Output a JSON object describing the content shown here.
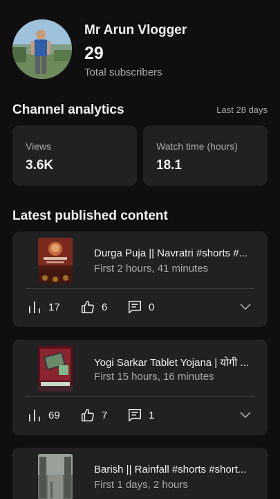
{
  "channel": {
    "name": "Mr Arun Vlogger",
    "subscriber_count": "29",
    "subscriber_label": "Total subscribers"
  },
  "analytics": {
    "title": "Channel analytics",
    "period": "Last 28 days",
    "metrics": [
      {
        "label": "Views",
        "value": "3.6K"
      },
      {
        "label": "Watch time (hours)",
        "value": "18.1"
      }
    ]
  },
  "latest": {
    "title": "Latest published content",
    "items": [
      {
        "title": "Durga Puja || Navratri #shorts #...",
        "subtitle": "First 2 hours, 41 minutes",
        "views": "17",
        "likes": "6",
        "comments": "0"
      },
      {
        "title": "Yogi Sarkar Tablet Yojana | योगी ...",
        "subtitle": "First 15 hours, 16 minutes",
        "views": "69",
        "likes": "7",
        "comments": "1"
      },
      {
        "title": "Barish || Rainfall #shorts #short...",
        "subtitle": "First 1 days, 2 hours"
      }
    ]
  },
  "icons": {
    "views": "bar-chart-icon",
    "likes": "thumbs-up-icon",
    "comments": "comment-icon",
    "expand": "chevron-down-icon"
  },
  "colors": {
    "background": "#0f0f0f",
    "card": "#212121",
    "text_primary": "#f1f1f1",
    "text_secondary": "#aaaaaa"
  }
}
